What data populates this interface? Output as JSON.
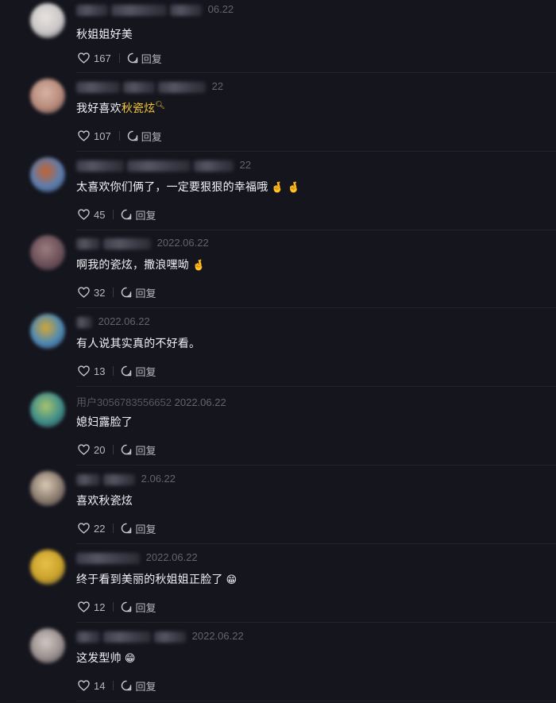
{
  "reply_label": "回复",
  "comments": [
    {
      "name": "",
      "date": "06.22",
      "text_pre": "秋姐姐好美",
      "text_hl": "",
      "emoji": "",
      "likes": "167",
      "avatar": "#c9c6c6",
      "ring": "#e8e3e0"
    },
    {
      "name": "",
      "date": "22",
      "text_pre": "我好喜欢",
      "text_hl": "秋瓷炫",
      "emoji": "",
      "likes": "107",
      "avatar": "#b88a7a",
      "ring": "#d6b3a6"
    },
    {
      "name": "",
      "date": "22",
      "text_pre": "太喜欢你们俩了，一定要狠狠的幸福哦",
      "text_hl": "",
      "emoji": "🤞 🤞",
      "likes": "45",
      "avatar": "#5a7fb2",
      "ring": "#c6622d"
    },
    {
      "name": "",
      "date": "2022.06.22",
      "text_pre": "啊我的瓷炫，撒浪嘿呦",
      "text_hl": "",
      "emoji": "🤞",
      "likes": "32",
      "avatar": "#6c5058",
      "ring": "#9a7c80"
    },
    {
      "name": "",
      "date": "2022.06.22",
      "text_pre": "有人说其实真的不好看。",
      "text_hl": "",
      "emoji": "",
      "likes": "13",
      "avatar": "#4c89b8",
      "ring": "#d2a735"
    },
    {
      "name": "用户3056783556652",
      "date": "2022.06.22",
      "text_pre": "媳妇露脸了",
      "text_hl": "",
      "emoji": "",
      "likes": "20",
      "avatar": "#3e8d8a",
      "ring": "#a9c46e"
    },
    {
      "name": "",
      "date": "2.06.22",
      "text_pre": "喜欢秋瓷炫",
      "text_hl": "",
      "emoji": "",
      "likes": "22",
      "avatar": "#8a7b6e",
      "ring": "#d9c9b5"
    },
    {
      "name": "",
      "date": "2022.06.22",
      "text_pre": "终于看到美丽的秋姐姐正脸了",
      "text_hl": "",
      "emoji": "😁",
      "likes": "12",
      "avatar": "#c9a12a",
      "ring": "#e6c24a"
    },
    {
      "name": "",
      "date": "2022.06.22",
      "text_pre": "这发型帅",
      "text_hl": "",
      "emoji": "😁",
      "likes": "14",
      "avatar": "#9a8f8d",
      "ring": "#d0c7c5"
    }
  ]
}
